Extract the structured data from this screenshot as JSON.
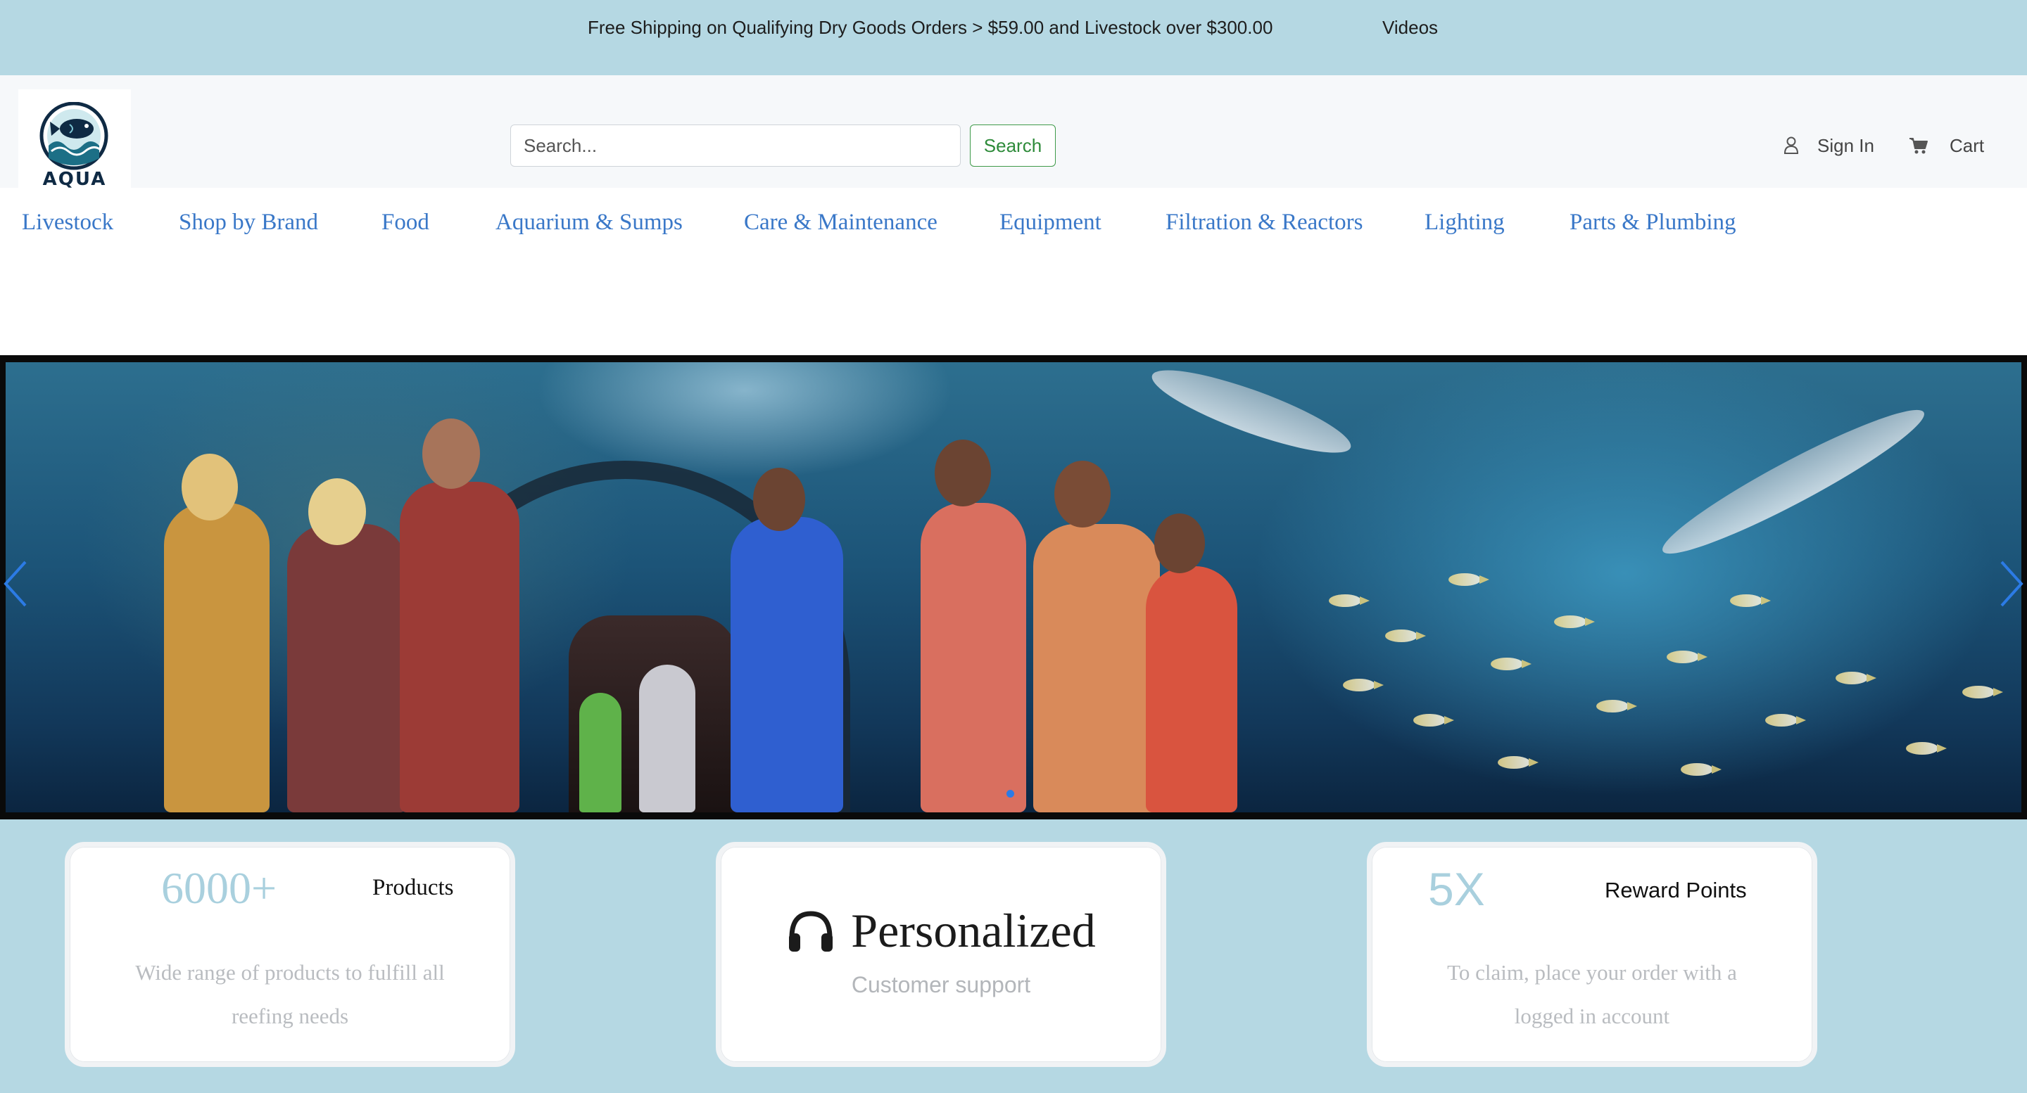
{
  "topbar": {
    "shipping_text": "Free Shipping on Qualifying Dry Goods Orders > $59.00 and Livestock over $300.00",
    "videos_label": "Videos"
  },
  "brand": {
    "logo_text": "AQUA"
  },
  "search": {
    "placeholder": "Search...",
    "button_label": "Search"
  },
  "account": {
    "sign_in_label": "Sign In",
    "cart_label": "Cart"
  },
  "nav": {
    "items": [
      {
        "label": "Livestock"
      },
      {
        "label": "Shop by Brand"
      },
      {
        "label": "Food"
      },
      {
        "label": "Aquarium & Sumps"
      },
      {
        "label": "Care & Maintenance"
      },
      {
        "label": "Equipment"
      },
      {
        "label": "Filtration & Reactors"
      },
      {
        "label": "Lighting"
      },
      {
        "label": "Parts & Plumbing"
      }
    ]
  },
  "hero": {
    "slide_count": 1,
    "active_slide": 1
  },
  "features": [
    {
      "value": "6000+",
      "label": "Products",
      "description": "Wide range of products to fulfill all reefing needs"
    },
    {
      "icon": "headphones-icon",
      "title": "Personalized",
      "subtitle": "Customer support"
    },
    {
      "value": "5X",
      "label": "Reward Points",
      "description": "To claim, place your order with a logged in account"
    }
  ],
  "colors": {
    "topbar_bg": "#b5d8e3",
    "header_bg": "#f6f8fa",
    "nav_link": "#3a78c8",
    "search_button": "#2e8b3a",
    "stat_accent": "#a9d0de",
    "slider_dot": "#2c7be5"
  }
}
